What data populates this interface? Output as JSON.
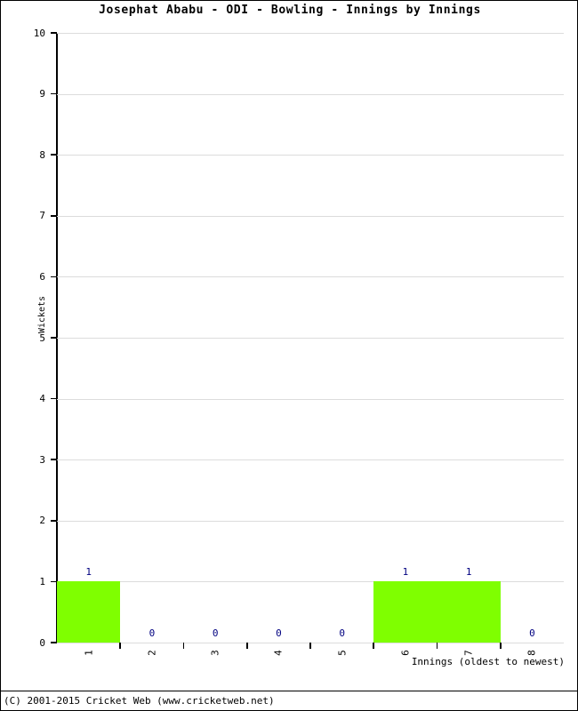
{
  "chart_data": {
    "type": "bar",
    "title": "Josephat Ababu - ODI - Bowling - Innings by Innings",
    "xlabel": "Innings (oldest to newest)",
    "ylabel": "Wickets",
    "categories": [
      "1",
      "2",
      "3",
      "4",
      "5",
      "6",
      "7",
      "8"
    ],
    "values": [
      1,
      0,
      0,
      0,
      0,
      1,
      1,
      0
    ],
    "value_labels": [
      "1",
      "0",
      "0",
      "0",
      "0",
      "1",
      "1",
      "0"
    ],
    "ylim": [
      0,
      10
    ],
    "y_ticks": [
      "0",
      "1",
      "2",
      "3",
      "4",
      "5",
      "6",
      "7",
      "8",
      "9",
      "10"
    ],
    "grid": true,
    "legend": "none",
    "bar_color": "#7FFF00",
    "value_label_color": "#000080",
    "gridline_color": "#DCDCDC",
    "axis_color": "#000000"
  },
  "footer": {
    "copyright": "(C) 2001-2015 Cricket Web (www.cricketweb.net)"
  }
}
